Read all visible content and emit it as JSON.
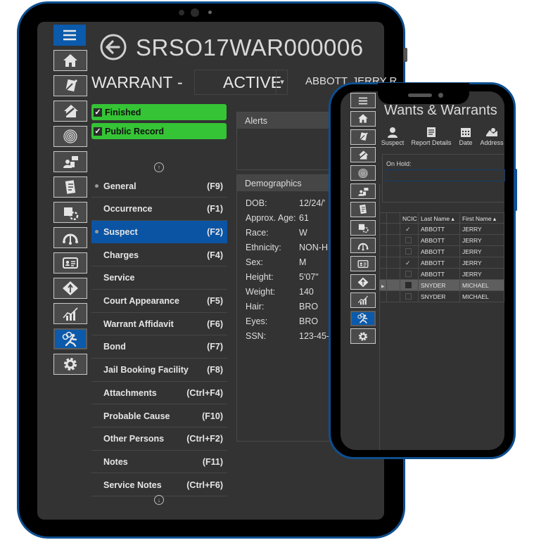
{
  "tablet": {
    "record_id": "SRSO17WAR000006",
    "record_type": "WARRANT",
    "separator": "-",
    "status": "ACTIVE",
    "person_name": "ABBOTT, JERRY R",
    "flags": [
      {
        "label": "Finished",
        "checked": true
      },
      {
        "label": "Public Record",
        "checked": true
      }
    ],
    "flag_color": "#35c435",
    "accent_color": "#0b54a3",
    "rail_icons": [
      "menu-icon",
      "home-icon",
      "report-icon",
      "burglary-icon",
      "fingerprint-icon",
      "property-icon",
      "notebook-icon",
      "evidence-icon",
      "traffic-icon",
      "id-card-icon",
      "directions-icon",
      "stats-icon",
      "warrant-icon",
      "gear-icon"
    ],
    "rail_active": "warrant-icon",
    "nav": [
      {
        "label": "General",
        "key": "(F9)",
        "dot": true,
        "selected": false
      },
      {
        "label": "Occurrence",
        "key": "(F1)",
        "dot": false,
        "selected": false
      },
      {
        "label": "Suspect",
        "key": "(F2)",
        "dot": true,
        "selected": true
      },
      {
        "label": "Charges",
        "key": "(F4)",
        "dot": false,
        "selected": false
      },
      {
        "label": "Service",
        "key": "",
        "dot": false,
        "selected": false
      },
      {
        "label": "Court Appearance",
        "key": "(F5)",
        "dot": false,
        "selected": false
      },
      {
        "label": "Warrant Affidavit",
        "key": "(F6)",
        "dot": false,
        "selected": false
      },
      {
        "label": "Bond",
        "key": "(F7)",
        "dot": false,
        "selected": false
      },
      {
        "label": "Jail Booking Facility",
        "key": "(F8)",
        "dot": false,
        "selected": false
      },
      {
        "label": "Attachments",
        "key": "(Ctrl+F4)",
        "dot": false,
        "selected": false
      },
      {
        "label": "Probable Cause",
        "key": "(F10)",
        "dot": false,
        "selected": false
      },
      {
        "label": "Other Persons",
        "key": "(Ctrl+F2)",
        "dot": false,
        "selected": false
      },
      {
        "label": "Notes",
        "key": "(F11)",
        "dot": false,
        "selected": false
      },
      {
        "label": "Service Notes",
        "key": "(Ctrl+F6)",
        "dot": false,
        "selected": false
      }
    ],
    "alerts_title": "Alerts",
    "demographics_title": "Demographics",
    "demographics": [
      {
        "k": "DOB:",
        "v": "12/24/'"
      },
      {
        "k": "Approx. Age:",
        "v": "61"
      },
      {
        "k": "Race:",
        "v": "W"
      },
      {
        "k": "Ethnicity:",
        "v": "NON-H"
      },
      {
        "k": "Sex:",
        "v": "M"
      },
      {
        "k": "Height:",
        "v": "5'07\""
      },
      {
        "k": "Weight:",
        "v": "140"
      },
      {
        "k": "Hair:",
        "v": "BRO"
      },
      {
        "k": "Eyes:",
        "v": "BRO"
      },
      {
        "k": "SSN:",
        "v": "123-45-"
      }
    ]
  },
  "phone": {
    "title": "Wants & Warrants",
    "toolbar": [
      {
        "label": "Suspect",
        "icon": "person-icon"
      },
      {
        "label": "Report Details",
        "icon": "document-icon"
      },
      {
        "label": "Date",
        "icon": "calendar-icon"
      },
      {
        "label": "Address",
        "icon": "map-icon"
      }
    ],
    "on_hold_label": "On Hold:",
    "on_hold_value": "",
    "grid": {
      "columns": [
        "",
        "",
        "NCIC",
        "Last Name ▴",
        "First Name ▴"
      ],
      "rows": [
        {
          "ncic": true,
          "last": "ABBOTT",
          "first": "JERRY",
          "selected": false
        },
        {
          "ncic": false,
          "last": "ABBOTT",
          "first": "JERRY",
          "selected": false
        },
        {
          "ncic": false,
          "last": "ABBOTT",
          "first": "JERRY",
          "selected": false
        },
        {
          "ncic": true,
          "last": "ABBOTT",
          "first": "JERRY",
          "selected": false
        },
        {
          "ncic": false,
          "last": "ABBOTT",
          "first": "JERRY",
          "selected": false
        },
        {
          "ncic": false,
          "last": "SNYDER",
          "first": "MICHAEL",
          "selected": true
        },
        {
          "ncic": false,
          "last": "SNYDER",
          "first": "MICHAEL",
          "selected": false
        }
      ]
    }
  }
}
